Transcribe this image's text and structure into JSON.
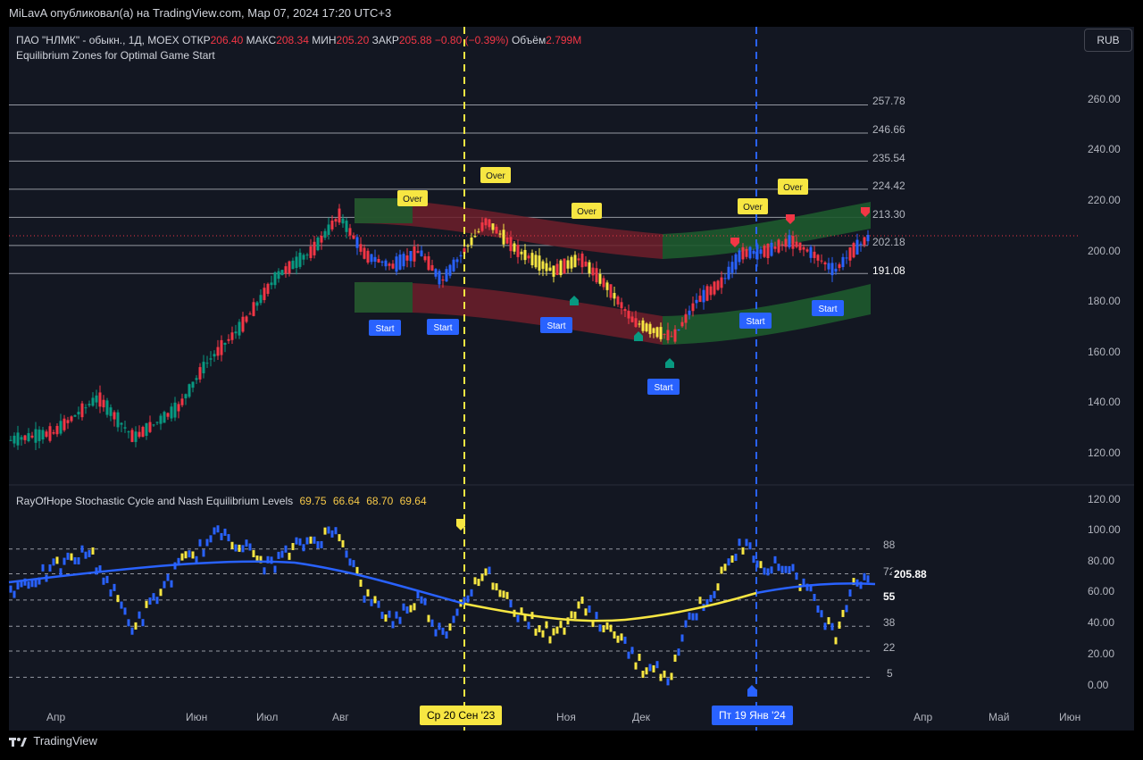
{
  "header": {
    "publish_text": "MiLavA опубликовал(а) на TradingView.com, Мар 07, 2024 17:20 UTC+3"
  },
  "symbol": {
    "name": "ПАО \"НЛМК\" - обыкн., 1Д, MOEX",
    "open_label": "ОТКР",
    "open": "206.40",
    "high_label": "МАКС",
    "high": "208.34",
    "low_label": "МИН",
    "low": "205.20",
    "close_label": "ЗАКР",
    "close": "205.88",
    "change": "−0.80 (−0.39%)",
    "volume_label": "Объём",
    "volume": "2.799M"
  },
  "indicator_main": {
    "name": "Equilibrium Zones for Optimal Game Start"
  },
  "currency_button": "RUB",
  "price_axis": [
    "260.00",
    "240.00",
    "220.00",
    "200.00",
    "180.00",
    "160.00",
    "140.00",
    "120.00"
  ],
  "levels": [
    {
      "value": 257.78,
      "label": "257.78"
    },
    {
      "value": 246.66,
      "label": "246.66"
    },
    {
      "value": 235.54,
      "label": "235.54"
    },
    {
      "value": 224.42,
      "label": "224.42"
    },
    {
      "value": 213.3,
      "label": "213.30"
    },
    {
      "value": 202.18,
      "label": "202.18"
    },
    {
      "value": 191.08,
      "label": "191.08"
    }
  ],
  "signals": {
    "over_label": "Over",
    "start_label": "Start"
  },
  "oscillator": {
    "name": "RayOfHope Stochastic Cycle and Nash Equilibrium Levels",
    "values": [
      "69.75",
      "66.64",
      "68.70",
      "69.64"
    ],
    "axis": [
      "120.00",
      "100.00",
      "80.00",
      "60.00",
      "40.00",
      "20.00",
      "0.00"
    ],
    "levels": [
      {
        "value": 88,
        "label": "88"
      },
      {
        "value": 72,
        "label": "72"
      },
      {
        "value": 55,
        "label": "55"
      },
      {
        "value": 38,
        "label": "38"
      },
      {
        "value": 22,
        "label": "22"
      },
      {
        "value": 5,
        "label": "5"
      }
    ],
    "price_tag": "205.88"
  },
  "time_axis": [
    "Апр",
    "Июн",
    "Июл",
    "Авг",
    "Ноя",
    "Дек",
    "Апр",
    "Май",
    "Июн"
  ],
  "date_flags": {
    "left": "Ср 20 Сен '23",
    "right": "Пт 19 Янв '24"
  },
  "colors": {
    "up": "#089981",
    "down": "#f23645",
    "blue": "#2962ff",
    "yellow": "#f7e642",
    "zone_green": "#1e5a2e",
    "zone_red": "#6e1f2a"
  },
  "footer": {
    "brand": "TradingView"
  }
}
